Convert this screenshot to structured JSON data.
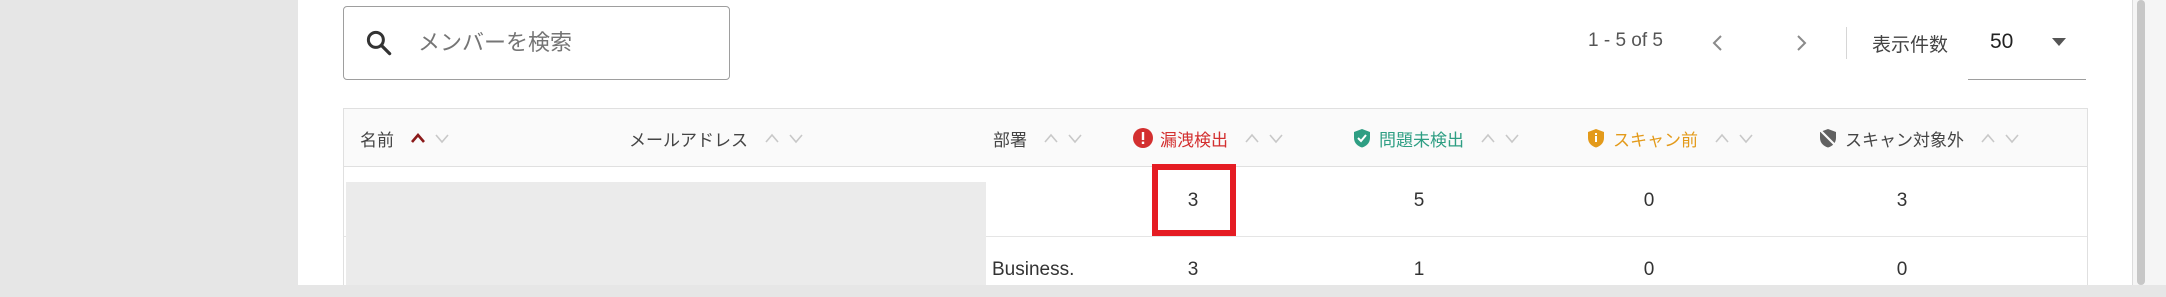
{
  "search": {
    "placeholder": "メンバーを検索"
  },
  "pagination": {
    "range": "1 - 5 of 5",
    "per_page_label": "表示件数",
    "per_page_value": "50"
  },
  "columns": {
    "name": "名前",
    "email": "メールアドレス",
    "department": "部署",
    "leak": "漏洩検出",
    "ok": "問題未検出",
    "pre": "スキャン前",
    "excluded": "スキャン対象外"
  },
  "rows": [
    {
      "department": "",
      "leak": "3",
      "ok": "5",
      "pre": "0",
      "excluded": "3"
    },
    {
      "department": "Business.",
      "leak": "3",
      "ok": "1",
      "pre": "0",
      "excluded": "0"
    }
  ],
  "colors": {
    "leak": "#d32f2f",
    "ok": "#2e9e83",
    "pre": "#e39a1a",
    "highlight": "#e51c23"
  }
}
